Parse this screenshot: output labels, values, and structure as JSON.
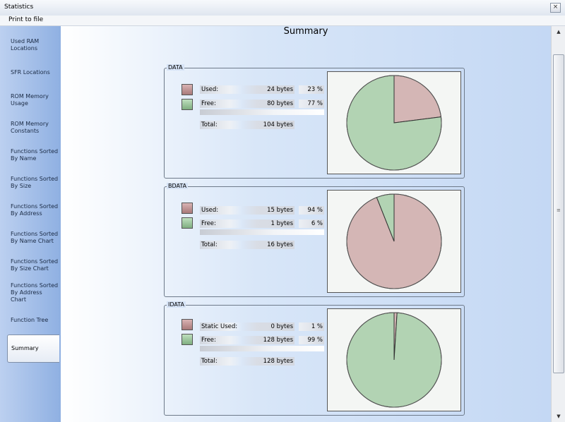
{
  "window": {
    "title": "Statistics",
    "close_glyph": "×"
  },
  "menu": {
    "print_label": "Print to file"
  },
  "sidebar": {
    "items": [
      {
        "label": "Used RAM Locations"
      },
      {
        "label": "SFR Locations"
      },
      {
        "label": "ROM Memory Usage"
      },
      {
        "label": "ROM Memory Constants"
      },
      {
        "label": "Functions Sorted By  Name"
      },
      {
        "label": "Functions Sorted By Size"
      },
      {
        "label": "Functions Sorted By Address"
      },
      {
        "label": "Functions Sorted By Name Chart"
      },
      {
        "label": "Functions Sorted By Size Chart"
      },
      {
        "label": "Functions Sorted By Address Chart"
      },
      {
        "label": "Function Tree"
      },
      {
        "label": "Summary"
      }
    ],
    "active_index": 11
  },
  "page": {
    "title": "Summary"
  },
  "groups": [
    {
      "name": "DATA",
      "used_label": "Used:",
      "used_value": "24 bytes",
      "used_pct": "23 %",
      "free_label": "Free:",
      "free_value": "80 bytes",
      "free_pct": "77 %",
      "total_label": "Total:",
      "total_value": "104 bytes"
    },
    {
      "name": "BDATA",
      "used_label": "Used:",
      "used_value": "15 bytes",
      "used_pct": "94 %",
      "free_label": "Free:",
      "free_value": "1 bytes",
      "free_pct": "6 %",
      "total_label": "Total:",
      "total_value": "16 bytes"
    },
    {
      "name": "IDATA",
      "used_label": "Static Used:",
      "used_value": "0 bytes",
      "used_pct": "1 %",
      "free_label": "Free:",
      "free_value": "128 bytes",
      "free_pct": "99 %",
      "total_label": "Total:",
      "total_value": "128 bytes"
    }
  ],
  "colors": {
    "used": "#c9a0a0",
    "free": "#9cc79e",
    "accent": "#8fb0e2"
  },
  "chart_data": [
    {
      "type": "pie",
      "categories": [
        "Used",
        "Free"
      ],
      "values": [
        23,
        77
      ]
    },
    {
      "type": "pie",
      "categories": [
        "Used",
        "Free"
      ],
      "values": [
        94,
        6
      ]
    },
    {
      "type": "pie",
      "categories": [
        "Static Used",
        "Free"
      ],
      "values": [
        1,
        99
      ]
    }
  ]
}
